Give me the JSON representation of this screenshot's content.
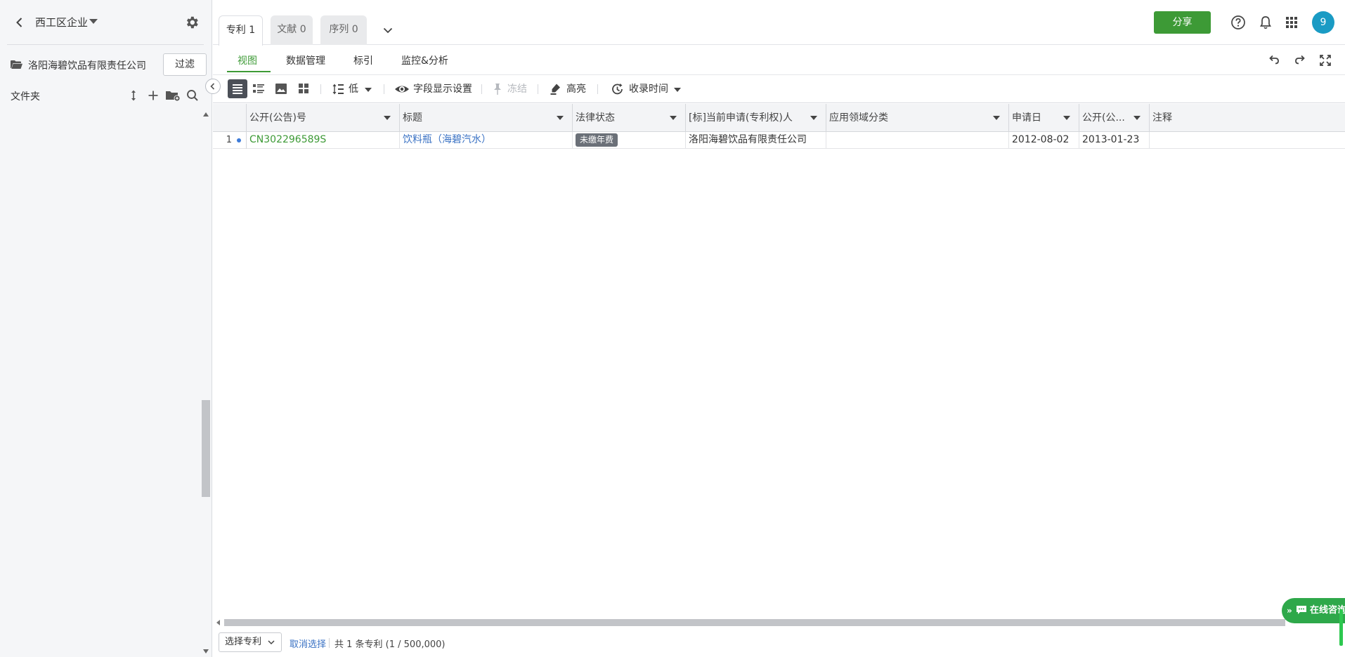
{
  "sidebar": {
    "workspace_title": "西工区企业",
    "company_folder": "洛阳海碧饮品有限责任公司",
    "filter_label": "过滤",
    "folders_label": "文件夹"
  },
  "tabs": [
    {
      "label": "专利 1",
      "active": true
    },
    {
      "label": "文献 0",
      "active": false
    },
    {
      "label": "序列 0",
      "active": false
    }
  ],
  "header": {
    "share_label": "分享",
    "avatar_text": "9"
  },
  "subtabs": [
    "视图",
    "数据管理",
    "标引",
    "监控&分析"
  ],
  "toolbar": {
    "density_label": "低",
    "field_settings_label": "字段显示设置",
    "freeze_label": "冻结",
    "highlight_label": "高亮",
    "sort_label": "收录时间"
  },
  "table": {
    "columns": [
      "公开(公告)号",
      "标题",
      "法律状态",
      "[标]当前申请(专利权)人",
      "应用领域分类",
      "申请日",
      "公开(公...",
      "注释"
    ],
    "rows": [
      {
        "num": "1",
        "pub_no": "CN302296589S",
        "title": "饮料瓶（海碧汽水）",
        "legal_status": "未缴年费",
        "applicant": "洛阳海碧饮品有限责任公司",
        "field_class": "",
        "app_date": "2012-08-02",
        "pub_date": "2013-01-23",
        "note": ""
      }
    ]
  },
  "footer": {
    "select_label": "选择专利",
    "cancel_select": "取消选择",
    "count_text": "共 1 条专利 (1 / 500,000)"
  },
  "consult_label": "在线咨询",
  "colors": {
    "brand_green": "#3d9a36",
    "link_blue": "#3a72c4",
    "avatar_blue": "#1a9bc4",
    "badge_gray": "#6b7078"
  }
}
